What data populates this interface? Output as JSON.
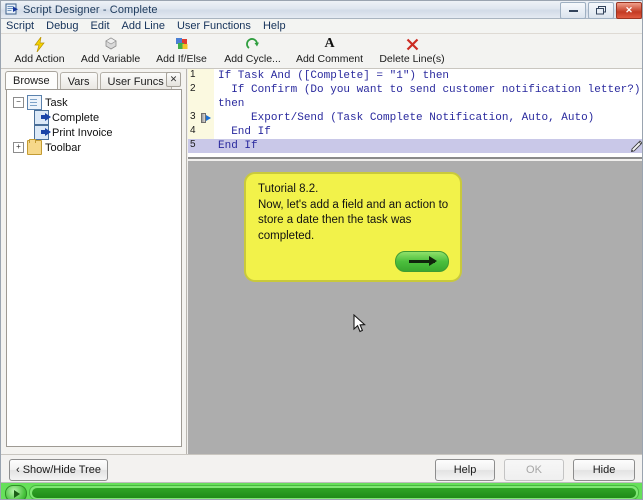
{
  "window": {
    "title": "Script Designer - Complete",
    "icon": "script-designer-icon",
    "minimize_label": "–",
    "restore_label": "❐",
    "close_label": "✕"
  },
  "menubar": {
    "items": [
      {
        "label": "Script"
      },
      {
        "label": "Debug"
      },
      {
        "label": "Edit"
      },
      {
        "label": "Add Line"
      },
      {
        "label": "User Functions"
      },
      {
        "label": "Help"
      }
    ]
  },
  "toolbar": {
    "buttons": [
      {
        "label": "Add Action",
        "icon": "lightning-bolt-icon",
        "glyph": "⚡"
      },
      {
        "label": "Add Variable",
        "icon": "cube-icon",
        "glyph": "⬢"
      },
      {
        "label": "Add If/Else",
        "icon": "branch-icon",
        "glyph": "❖"
      },
      {
        "label": "Add Cycle...",
        "icon": "loop-arrow-icon",
        "glyph": "↷"
      },
      {
        "label": "Add Comment",
        "icon": "letter-a-icon",
        "glyph": "A"
      },
      {
        "label": "Delete Line(s)",
        "icon": "red-x-icon",
        "glyph": "✕"
      }
    ]
  },
  "left_panel": {
    "tabs": [
      {
        "label": "Browse",
        "active": true
      },
      {
        "label": "Vars",
        "active": false
      },
      {
        "label": "User Funcs",
        "active": false
      }
    ],
    "close_label": "✕",
    "tree": [
      {
        "label": "Task",
        "icon": "document-icon",
        "expander": "−",
        "level": 0
      },
      {
        "label": "Complete",
        "icon": "script-icon",
        "expander": "",
        "level": 1
      },
      {
        "label": "Print Invoice",
        "icon": "script-icon",
        "expander": "",
        "level": 1
      },
      {
        "label": "Toolbar",
        "icon": "folder-icon",
        "expander": "+",
        "level": 0
      }
    ]
  },
  "editor": {
    "lines": [
      {
        "num": "1",
        "text": "If Task And ([Complete] = \"1\") then",
        "marker": "",
        "selected": false
      },
      {
        "num": "2",
        "text": "  If Confirm (Do you want to send customer notification letter?) then",
        "marker": "",
        "selected": false
      },
      {
        "num": "3",
        "text": "     Export/Send (Task Complete Notification, Auto, Auto)",
        "marker": "breakpoint-arrow",
        "selected": false
      },
      {
        "num": "4",
        "text": "  End If",
        "marker": "",
        "selected": false
      },
      {
        "num": "5",
        "text": "End If",
        "marker": "",
        "selected": true
      }
    ],
    "edit_icon": "pencil-icon"
  },
  "tutorial": {
    "text": "Tutorial 8.2.\nNow, let's add a field and an action to store a date then the task was completed.",
    "next_icon": "right-arrow-icon"
  },
  "bottom_bar": {
    "show_hide_tree": "‹ Show/Hide Tree",
    "help": "Help",
    "ok": "OK",
    "hide": "Hide"
  },
  "progress": {
    "play_icon": "play-icon",
    "percent": 100
  },
  "colors": {
    "canvas": "#adadad",
    "tutorial_bg": "#f2f24a",
    "selection": "#c9c8e8",
    "gutter": "#fbf9e0",
    "code_text": "#2a2a9e",
    "progress_green": "#66e05a",
    "close_red": "#c33a22"
  }
}
